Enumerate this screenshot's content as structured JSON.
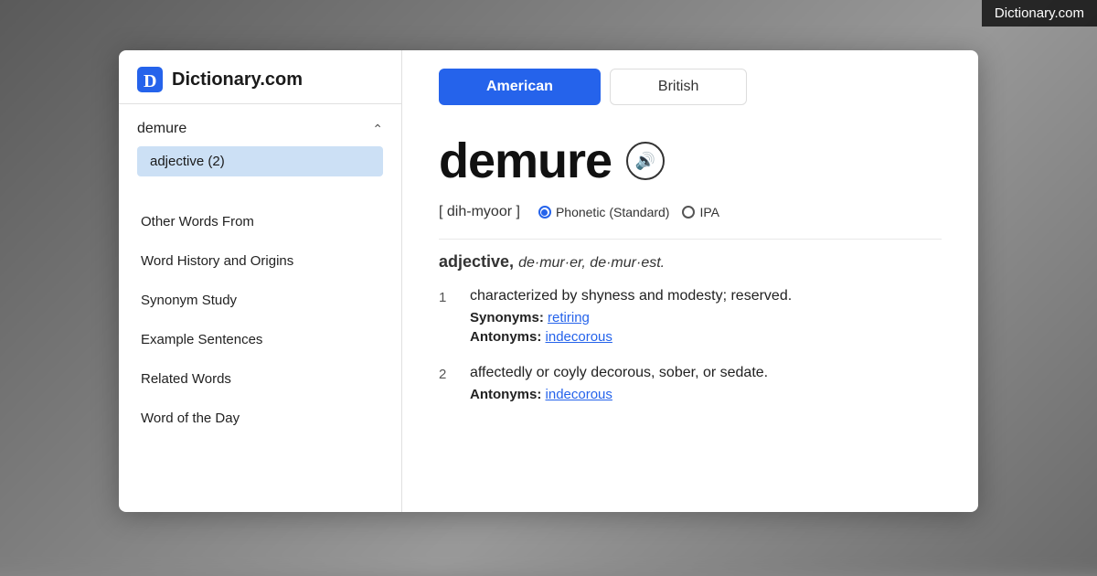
{
  "watermark": {
    "text": "Dictionary.com"
  },
  "sidebar": {
    "logo_text": "Dictionary.com",
    "word": "demure",
    "pos_label": "adjective (2)",
    "nav_items": [
      "Other Words From",
      "Word History and Origins",
      "Synonym Study",
      "Example Sentences",
      "Related Words",
      "Word of the Day"
    ]
  },
  "content": {
    "tab_american": "American",
    "tab_british": "British",
    "word": "demure",
    "speaker_icon": "🔊",
    "phonetic_bracket_open": "[",
    "phonetic_text": "dih-myoor",
    "phonetic_bracket_close": "]",
    "phonetic_standard_label": "Phonetic (Standard)",
    "phonetic_ipa_label": "IPA",
    "pos_line": "adjective,",
    "comparatives": "de·mur·er, de·mur·est.",
    "definitions": [
      {
        "num": "1",
        "text": "characterized by shyness and modesty; reserved.",
        "synonyms_label": "Synonyms:",
        "synonyms_link": "retiring",
        "antonyms_label": "Antonyms:",
        "antonyms_link": "indecorous"
      },
      {
        "num": "2",
        "text": "affectedly or coyly decorous, sober, or sedate.",
        "antonyms_label": "Antonyms:",
        "antonyms_link": "indecorous"
      }
    ]
  }
}
